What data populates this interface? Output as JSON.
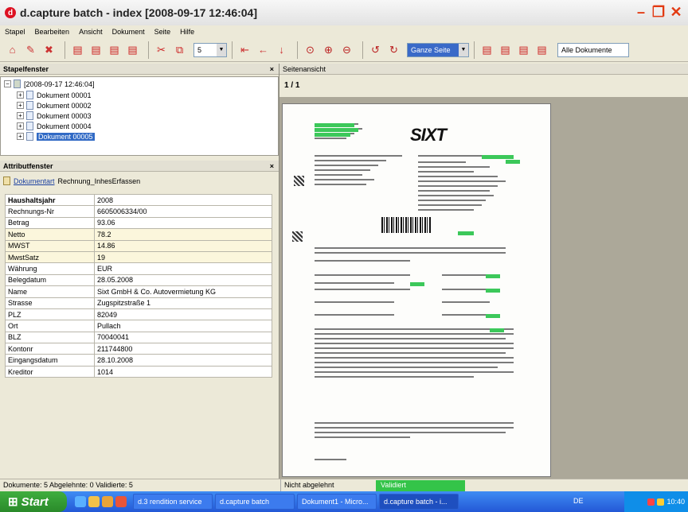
{
  "window": {
    "title": "d.capture batch - index [2008-09-17 12:46:04]"
  },
  "menu": [
    "Stapel",
    "Bearbeiten",
    "Ansicht",
    "Dokument",
    "Seite",
    "Hilfe"
  ],
  "toolbar": {
    "page_count_value": "5",
    "zoom_value": "Ganze Seite",
    "filter_value": "Alle Dokumente"
  },
  "stapel": {
    "title": "Stapelfenster",
    "close": "×",
    "root": "[2008-09-17 12:46:04]",
    "documents": [
      "Dokument 00001",
      "Dokument 00002",
      "Dokument 00003",
      "Dokument 00004",
      "Dokument 00005"
    ]
  },
  "attribute": {
    "title": "Attributfenster",
    "close": "×",
    "doc_type_link": "Dokumentart",
    "doc_type_value": "Rechnung_InhesErfassen",
    "rows": [
      {
        "key": "Haushaltsjahr",
        "value": "2008"
      },
      {
        "key": "Rechnungs-Nr",
        "value": "6605006334/00"
      },
      {
        "key": "Betrag",
        "value": "93.06"
      },
      {
        "key": "Netto",
        "value": "78.2"
      },
      {
        "key": "MWST",
        "value": "14.86"
      },
      {
        "key": "MwstSatz",
        "value": "19"
      },
      {
        "key": "Währung",
        "value": "EUR"
      },
      {
        "key": "Belegdatum",
        "value": "28.05.2008"
      },
      {
        "key": "Name",
        "value": "Sixt GmbH & Co. Autovermietung KG"
      },
      {
        "key": "Strasse",
        "value": "Zugspitzstraße 1"
      },
      {
        "key": "PLZ",
        "value": "82049"
      },
      {
        "key": "Ort",
        "value": "Pullach"
      },
      {
        "key": "BLZ",
        "value": "70040041"
      },
      {
        "key": "Kontonr",
        "value": "211744800"
      },
      {
        "key": "Eingangsdatum",
        "value": "28.10.2008"
      },
      {
        "key": "Kreditor",
        "value": "1014"
      }
    ]
  },
  "viewer": {
    "title": "Seitenansicht",
    "pager": "1 / 1",
    "logo": "SIXT"
  },
  "status": {
    "left": "Dokumente: 5 Abgelehnte: 0 Validierte: 5",
    "mid": "Nicht abgelehnt",
    "right": "Validiert"
  },
  "taskbar": {
    "start": "Start",
    "tasks": [
      "d.3 rendition service",
      "d.capture batch",
      "Dokument1 - Micro...",
      "d.capture batch - i..."
    ],
    "lang": "DE",
    "clock": "10:40"
  }
}
